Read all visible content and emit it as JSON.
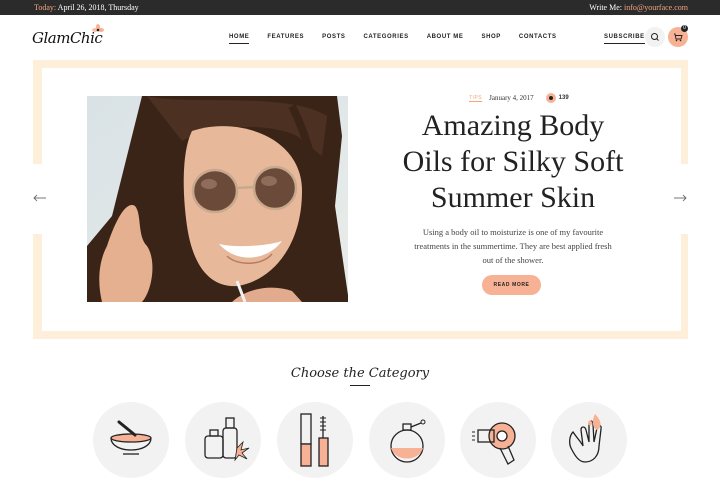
{
  "topbar": {
    "today_label": "Today:",
    "today_value": "April 26, 2018, Thursday",
    "write_label": "Write Me:",
    "email": "info@yourface.com"
  },
  "header": {
    "logo": "GlamChic",
    "nav": [
      "HOME",
      "FEATURES",
      "POSTS",
      "CATEGORIES",
      "ABOUT ME",
      "SHOP",
      "CONTACTS"
    ],
    "active_nav": "HOME",
    "subscribe": "SUBSCRIBE",
    "cart_count": "0"
  },
  "slide": {
    "tag": "TIPS",
    "date": "January 4, 2017",
    "views": "139",
    "title_line1": "Amazing Body",
    "title_line2": "Oils for Silky Soft",
    "title_line3": "Summer Skin",
    "excerpt": "Using a body oil to moisturize is one of my favourite treatments in the summertime. They are best applied fresh out of the shower.",
    "button": "READ MORE"
  },
  "categories": {
    "title": "Choose the Category",
    "icons": [
      "mortar-pestle-icon",
      "oil-bottles-icon",
      "mascara-icon",
      "perfume-icon",
      "hair-dryer-icon",
      "manicure-hand-icon"
    ]
  },
  "colors": {
    "accent": "#f7b295",
    "accent_text": "#f3a37f",
    "frame": "#fdefd9",
    "topbar": "#2b2b2b",
    "circle_bg": "#f2f2f2"
  }
}
